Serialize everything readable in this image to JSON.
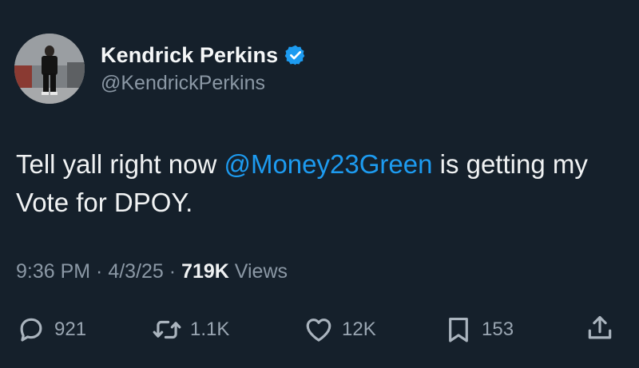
{
  "author": {
    "display_name": "Kendrick Perkins",
    "handle": "@KendrickPerkins",
    "verified": true
  },
  "tweet": {
    "text_before": "Tell yall right now ",
    "mention": "@Money23Green",
    "text_after": " is getting my Vote for DPOY."
  },
  "meta": {
    "time": "9:36 PM",
    "sep1": " · ",
    "date": "4/3/25",
    "sep2": " · ",
    "views_count": "719K",
    "views_label": " Views"
  },
  "actions": {
    "replies": "921",
    "reposts": "1.1K",
    "likes": "12K",
    "bookmarks": "153"
  },
  "colors": {
    "background": "#15202b",
    "accent": "#1d9bf0",
    "secondary_text": "#8b98a5"
  },
  "icons": [
    "verified-badge-icon",
    "reply-icon",
    "repost-icon",
    "like-icon",
    "bookmark-icon",
    "share-icon"
  ]
}
